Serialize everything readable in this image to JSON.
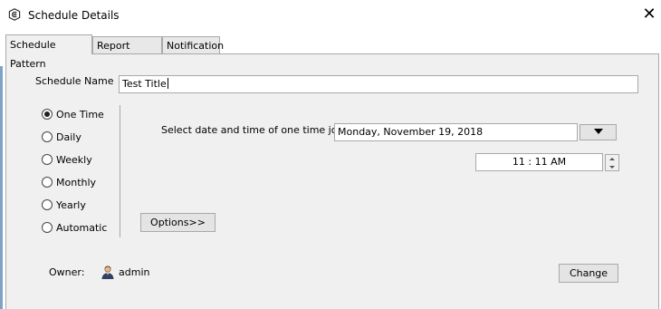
{
  "window": {
    "title": "Schedule Details",
    "icon": "app-shield-icon",
    "close_glyph": "✕"
  },
  "tabs": [
    {
      "label": "Schedule Pattern",
      "active": true
    },
    {
      "label": "Report Details",
      "active": false
    },
    {
      "label": "Notification",
      "active": false
    }
  ],
  "form": {
    "schedule_name_label": "Schedule Name",
    "schedule_name_value": "Test Title",
    "date_prompt": "Select date and time of one time job",
    "date_value": "Monday, November 19, 2018",
    "time_value": "11 : 11 AM",
    "options_button": "Options>>",
    "owner_label": "Owner:",
    "owner_value": "admin",
    "change_button": "Change"
  },
  "frequency": {
    "selected": "One Time",
    "options": [
      "One Time",
      "Daily",
      "Weekly",
      "Monthly",
      "Yearly",
      "Automatic"
    ]
  },
  "colors": {
    "panel_bg": "#f0f0f0",
    "border": "#a9a9a9",
    "accent_strip": "#7ea3c8"
  }
}
